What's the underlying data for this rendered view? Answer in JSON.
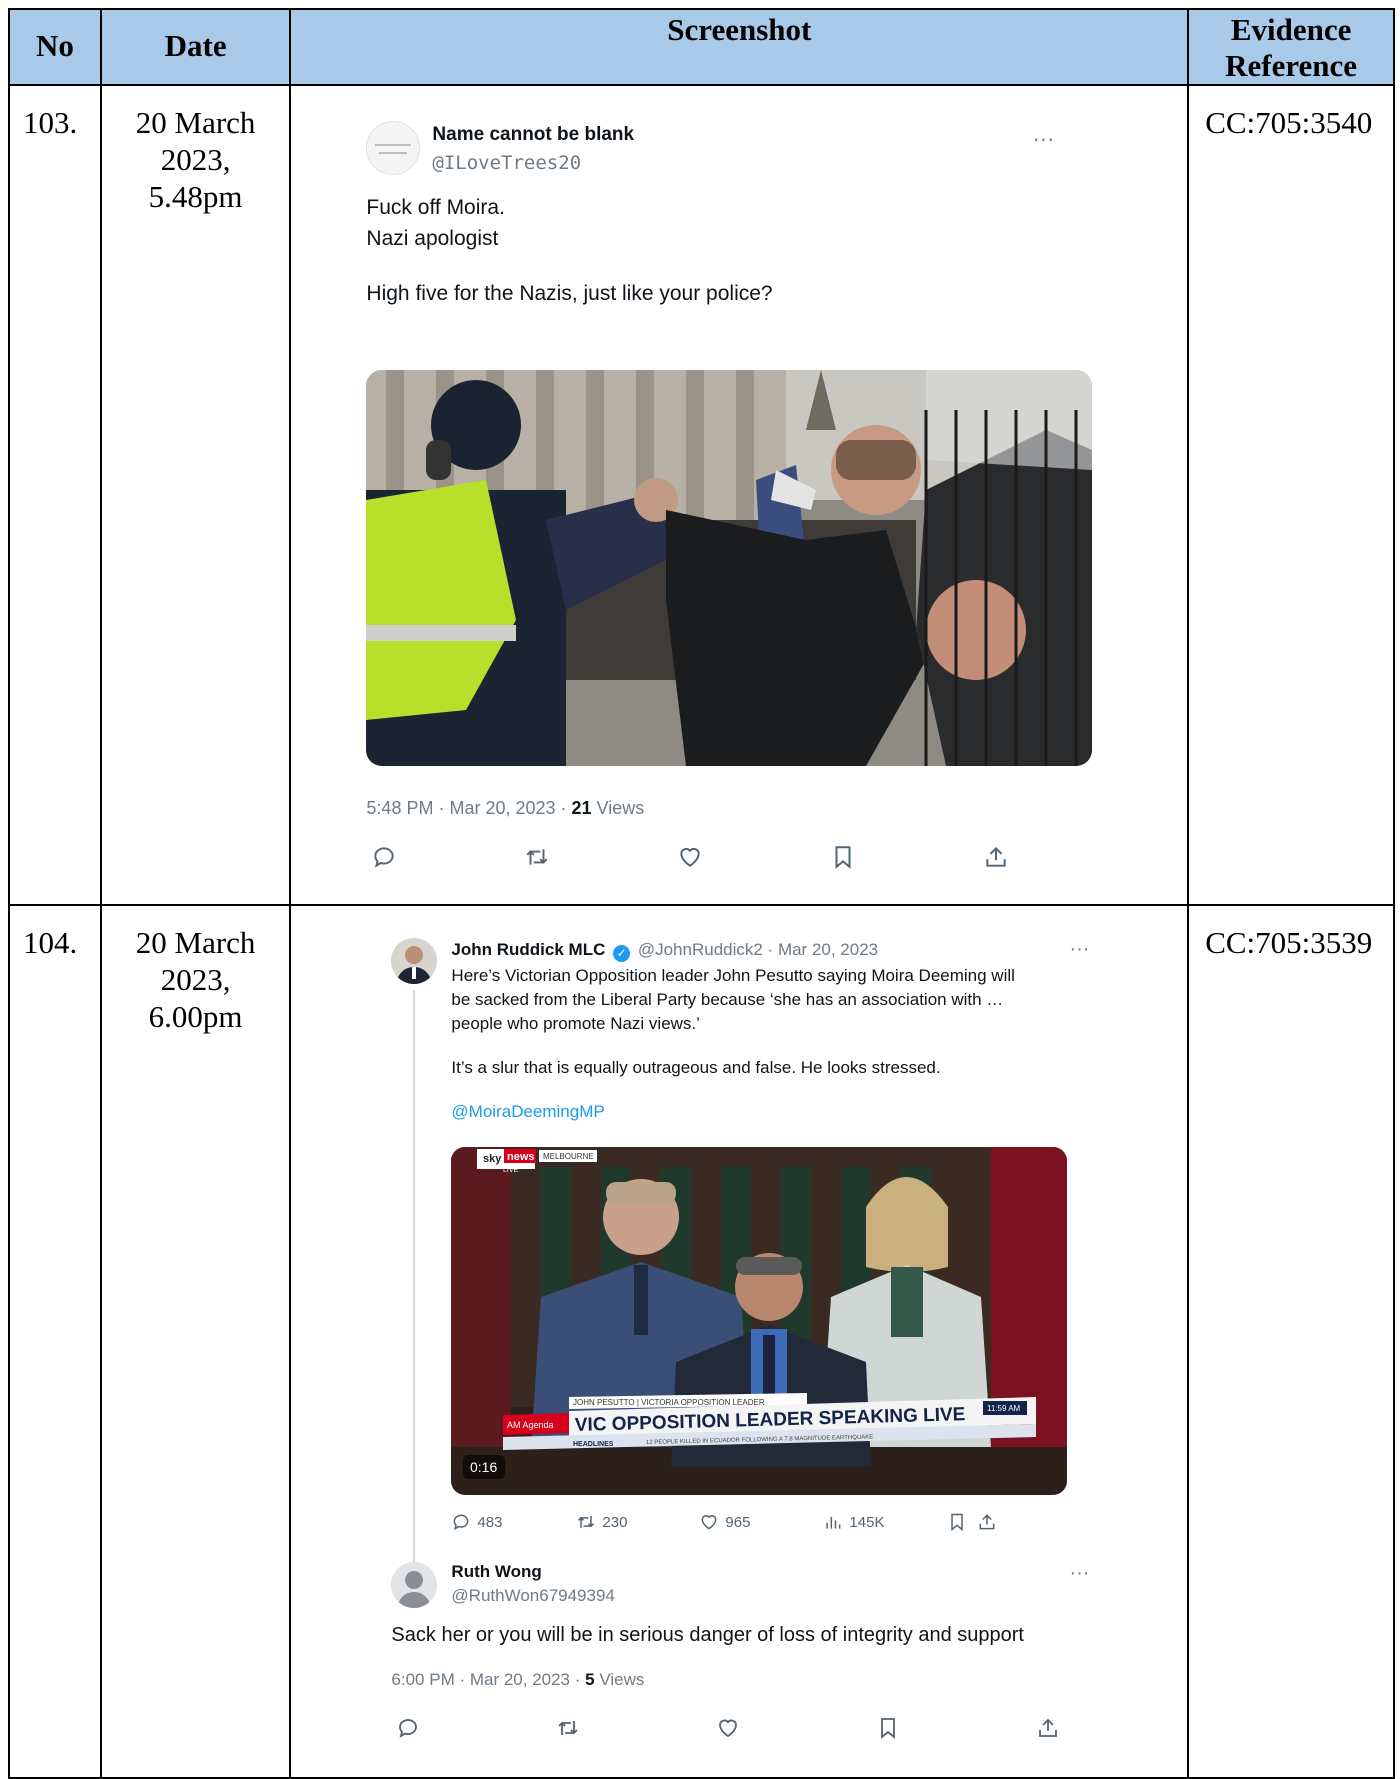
{
  "table": {
    "headers": {
      "no": "No",
      "date": "Date",
      "screenshot": "Screenshot",
      "evidence_line1": "Evidence",
      "evidence_line2": "Reference"
    },
    "rows": [
      {
        "no": "103.",
        "date_line1": "20 March",
        "date_line2": "2023,",
        "date_line3": "5.48pm",
        "evidence": "CC:705:3540",
        "tweet": {
          "name": "Name cannot be blank",
          "handle": "@ILoveTrees20",
          "more": "···",
          "text_line1": "Fuck off Moira.",
          "text_line2": "Nazi apologist",
          "text_line3": "High five for the Nazis, just like your police?",
          "meta_time": "5:48 PM · Mar 20, 2023 · ",
          "meta_views_count": "21",
          "meta_views_label": " Views",
          "actions": [
            "reply-icon",
            "retweet-icon",
            "like-icon",
            "bookmark-icon",
            "share-icon"
          ]
        }
      },
      {
        "no": "104.",
        "date_line1": "20 March",
        "date_line2": "2023,",
        "date_line3": "6.00pm",
        "evidence": "CC:705:3539",
        "tweet": {
          "name": "John Ruddick MLC",
          "handle_date": "@JohnRuddick2 · Mar 20, 2023",
          "more": "···",
          "body_line1": "Here’s Victorian Opposition leader John Pesutto saying Moira Deeming will",
          "body_line2": "be sacked from the Liberal Party because ‘she has an association with …",
          "body_line3": "people who promote Nazi views.’",
          "body_para2": "It’s a slur that is equally outrageous and false. He looks stressed.",
          "mention": "@MoiraDeemingMP",
          "video": {
            "channel_sky": "sky",
            "channel_news": "news",
            "channel_region": "MELBOURNE",
            "live": "LIVE",
            "program": "AM Agenda",
            "strap_name": "JOHN PESUTTO | VICTORIA OPPOSITION LEADER",
            "strap_headline": "VIC OPPOSITION LEADER SPEAKING LIVE",
            "strap_time": "11:59 AM",
            "ticker_label": "HEADLINES",
            "ticker_text": "12 PEOPLE KILLED IN ECUADOR FOLLOWING A 7.8 MAGNITUDE EARTHQUAKE",
            "duration": "0:16"
          },
          "stats": {
            "replies": "483",
            "retweets": "230",
            "likes": "965",
            "views": "145K"
          },
          "reply": {
            "name": "Ruth Wong",
            "handle": "@RuthWon67949394",
            "more": "···",
            "text": "Sack her or you will be in serious danger of loss of integrity and support",
            "meta_time": "6:00 PM · Mar 20, 2023 · ",
            "meta_views_count": "5",
            "meta_views_label": " Views"
          }
        }
      }
    ]
  },
  "colors": {
    "header_bg": "#a9c9e8",
    "link": "#1d9bf0",
    "muted": "#6f7b85",
    "verified": "#1d9bf0",
    "sky_red": "#d6001c"
  }
}
